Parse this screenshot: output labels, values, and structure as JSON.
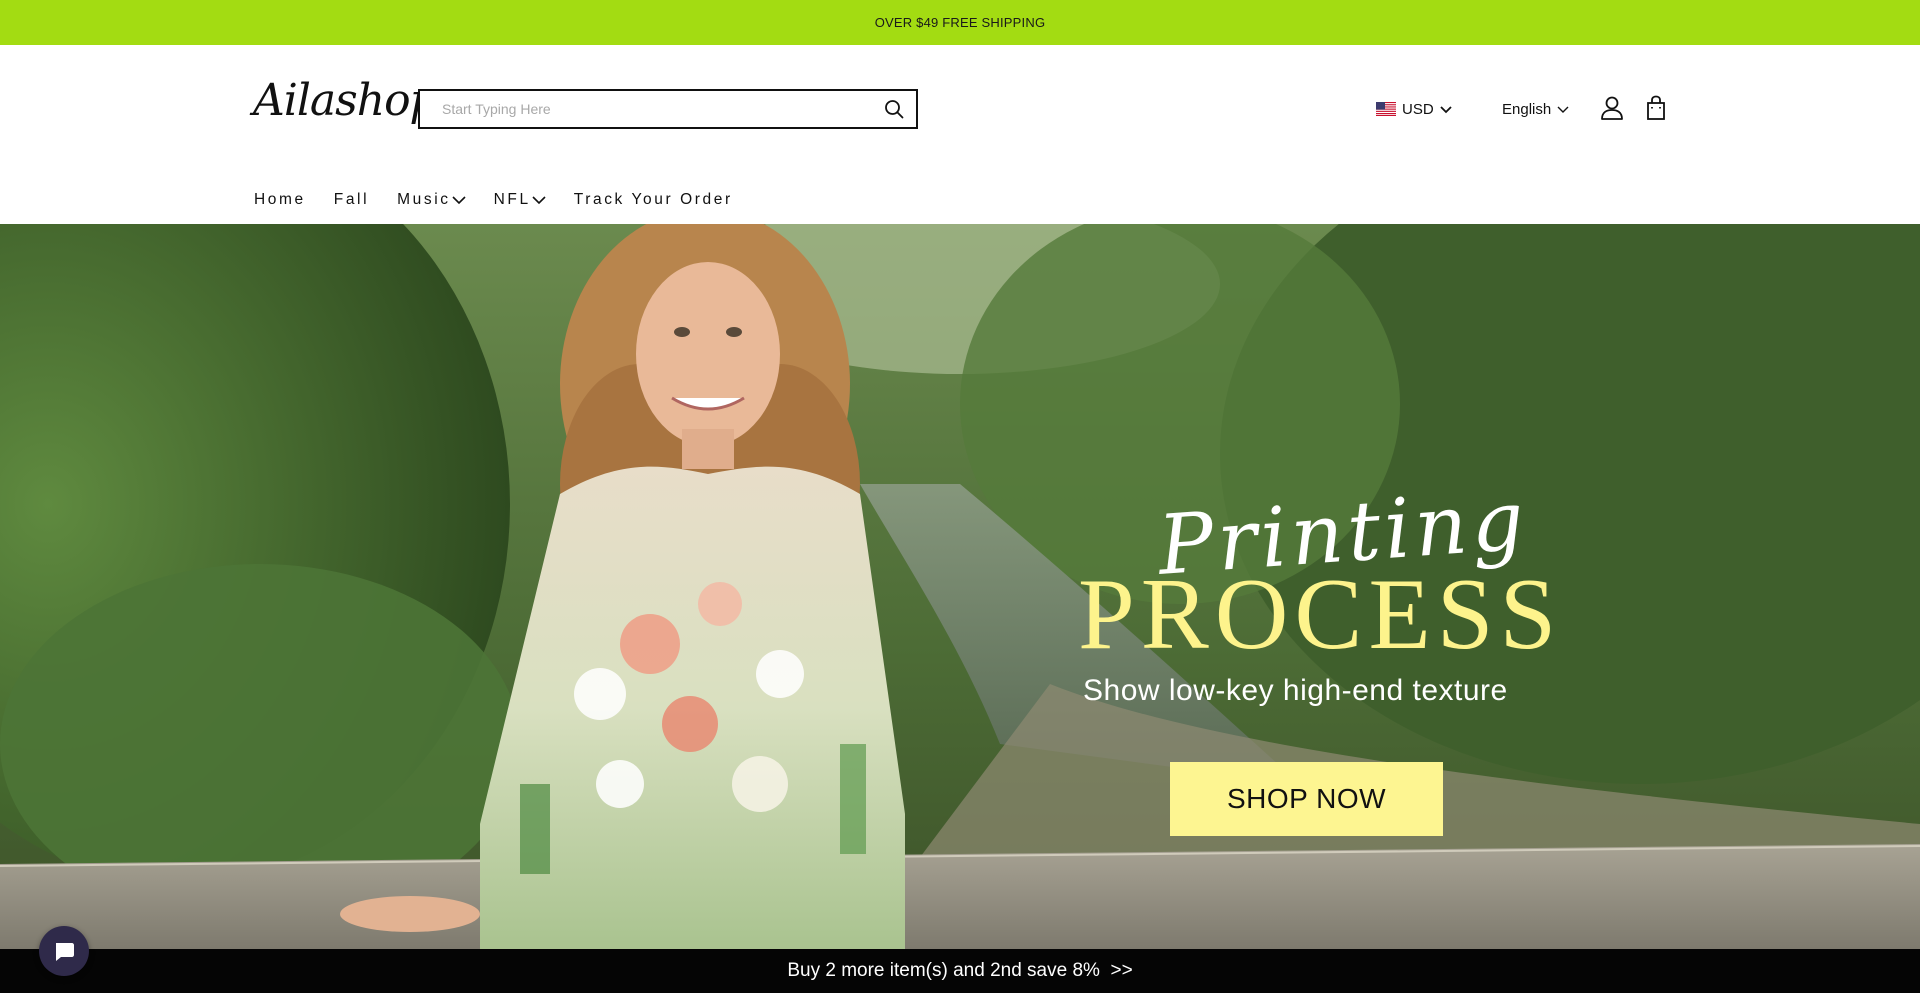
{
  "announcement": {
    "text": "OVER $49 FREE SHIPPING"
  },
  "header": {
    "logo_text": "Ailashop",
    "search": {
      "placeholder": "Start Typing Here",
      "value": ""
    },
    "currency": {
      "label": "USD",
      "flag_icon": "us-flag-icon"
    },
    "language": {
      "label": "English"
    },
    "icons": [
      "search-icon",
      "user-icon",
      "shopping-bag-icon",
      "chevron-down-icon"
    ]
  },
  "nav": {
    "items": [
      {
        "label": "Home",
        "has_dropdown": false
      },
      {
        "label": "Fall",
        "has_dropdown": false
      },
      {
        "label": "Music",
        "has_dropdown": true
      },
      {
        "label": "NFL",
        "has_dropdown": true
      },
      {
        "label": "Track Your Order",
        "has_dropdown": false
      }
    ]
  },
  "hero": {
    "script_text": "Printing",
    "title": "PROCESS",
    "subtitle": "Show low-key high-end texture",
    "button_label": "SHOP NOW"
  },
  "bottom_bar": {
    "text": "Buy 2 more item(s) and 2nd save 8%  >>"
  },
  "chat": {
    "icon": "chat-bubble-icon"
  },
  "colors": {
    "announcement_bg": "#a3dc12",
    "hero_title": "#fdf38c",
    "shop_button_bg": "#fdf591",
    "bottom_bar_bg": "#050505",
    "chat_bg": "#2f2a4a"
  }
}
